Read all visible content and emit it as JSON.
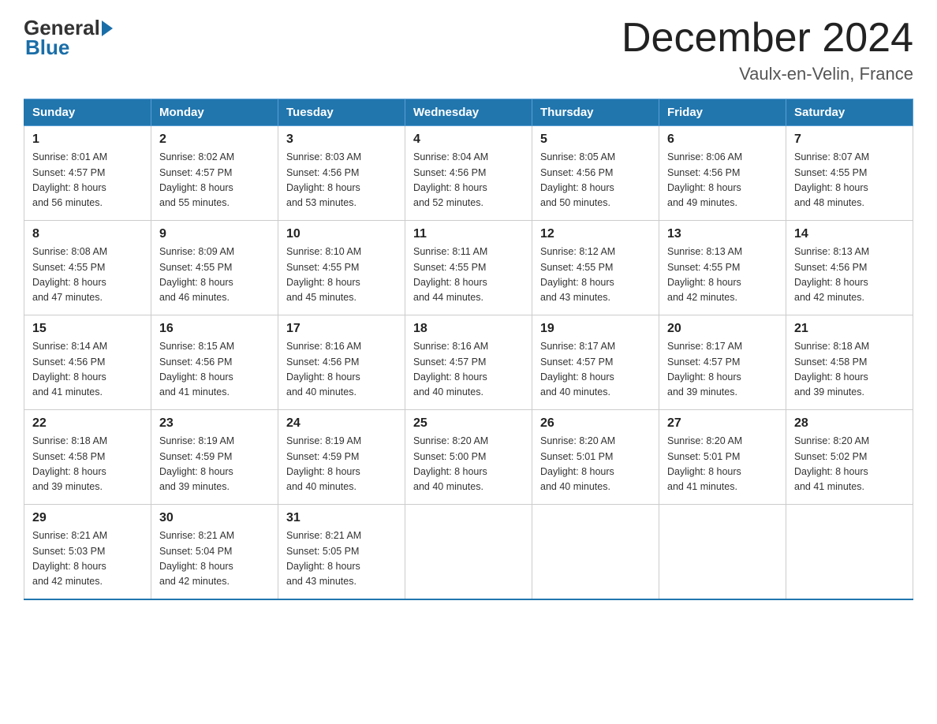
{
  "header": {
    "logo_general": "General",
    "logo_blue": "Blue",
    "month_title": "December 2024",
    "location": "Vaulx-en-Velin, France"
  },
  "weekdays": [
    "Sunday",
    "Monday",
    "Tuesday",
    "Wednesday",
    "Thursday",
    "Friday",
    "Saturday"
  ],
  "weeks": [
    [
      {
        "day": "1",
        "sunrise": "8:01 AM",
        "sunset": "4:57 PM",
        "daylight": "8 hours and 56 minutes."
      },
      {
        "day": "2",
        "sunrise": "8:02 AM",
        "sunset": "4:57 PM",
        "daylight": "8 hours and 55 minutes."
      },
      {
        "day": "3",
        "sunrise": "8:03 AM",
        "sunset": "4:56 PM",
        "daylight": "8 hours and 53 minutes."
      },
      {
        "day": "4",
        "sunrise": "8:04 AM",
        "sunset": "4:56 PM",
        "daylight": "8 hours and 52 minutes."
      },
      {
        "day": "5",
        "sunrise": "8:05 AM",
        "sunset": "4:56 PM",
        "daylight": "8 hours and 50 minutes."
      },
      {
        "day": "6",
        "sunrise": "8:06 AM",
        "sunset": "4:56 PM",
        "daylight": "8 hours and 49 minutes."
      },
      {
        "day": "7",
        "sunrise": "8:07 AM",
        "sunset": "4:55 PM",
        "daylight": "8 hours and 48 minutes."
      }
    ],
    [
      {
        "day": "8",
        "sunrise": "8:08 AM",
        "sunset": "4:55 PM",
        "daylight": "8 hours and 47 minutes."
      },
      {
        "day": "9",
        "sunrise": "8:09 AM",
        "sunset": "4:55 PM",
        "daylight": "8 hours and 46 minutes."
      },
      {
        "day": "10",
        "sunrise": "8:10 AM",
        "sunset": "4:55 PM",
        "daylight": "8 hours and 45 minutes."
      },
      {
        "day": "11",
        "sunrise": "8:11 AM",
        "sunset": "4:55 PM",
        "daylight": "8 hours and 44 minutes."
      },
      {
        "day": "12",
        "sunrise": "8:12 AM",
        "sunset": "4:55 PM",
        "daylight": "8 hours and 43 minutes."
      },
      {
        "day": "13",
        "sunrise": "8:13 AM",
        "sunset": "4:55 PM",
        "daylight": "8 hours and 42 minutes."
      },
      {
        "day": "14",
        "sunrise": "8:13 AM",
        "sunset": "4:56 PM",
        "daylight": "8 hours and 42 minutes."
      }
    ],
    [
      {
        "day": "15",
        "sunrise": "8:14 AM",
        "sunset": "4:56 PM",
        "daylight": "8 hours and 41 minutes."
      },
      {
        "day": "16",
        "sunrise": "8:15 AM",
        "sunset": "4:56 PM",
        "daylight": "8 hours and 41 minutes."
      },
      {
        "day": "17",
        "sunrise": "8:16 AM",
        "sunset": "4:56 PM",
        "daylight": "8 hours and 40 minutes."
      },
      {
        "day": "18",
        "sunrise": "8:16 AM",
        "sunset": "4:57 PM",
        "daylight": "8 hours and 40 minutes."
      },
      {
        "day": "19",
        "sunrise": "8:17 AM",
        "sunset": "4:57 PM",
        "daylight": "8 hours and 40 minutes."
      },
      {
        "day": "20",
        "sunrise": "8:17 AM",
        "sunset": "4:57 PM",
        "daylight": "8 hours and 39 minutes."
      },
      {
        "day": "21",
        "sunrise": "8:18 AM",
        "sunset": "4:58 PM",
        "daylight": "8 hours and 39 minutes."
      }
    ],
    [
      {
        "day": "22",
        "sunrise": "8:18 AM",
        "sunset": "4:58 PM",
        "daylight": "8 hours and 39 minutes."
      },
      {
        "day": "23",
        "sunrise": "8:19 AM",
        "sunset": "4:59 PM",
        "daylight": "8 hours and 39 minutes."
      },
      {
        "day": "24",
        "sunrise": "8:19 AM",
        "sunset": "4:59 PM",
        "daylight": "8 hours and 40 minutes."
      },
      {
        "day": "25",
        "sunrise": "8:20 AM",
        "sunset": "5:00 PM",
        "daylight": "8 hours and 40 minutes."
      },
      {
        "day": "26",
        "sunrise": "8:20 AM",
        "sunset": "5:01 PM",
        "daylight": "8 hours and 40 minutes."
      },
      {
        "day": "27",
        "sunrise": "8:20 AM",
        "sunset": "5:01 PM",
        "daylight": "8 hours and 41 minutes."
      },
      {
        "day": "28",
        "sunrise": "8:20 AM",
        "sunset": "5:02 PM",
        "daylight": "8 hours and 41 minutes."
      }
    ],
    [
      {
        "day": "29",
        "sunrise": "8:21 AM",
        "sunset": "5:03 PM",
        "daylight": "8 hours and 42 minutes."
      },
      {
        "day": "30",
        "sunrise": "8:21 AM",
        "sunset": "5:04 PM",
        "daylight": "8 hours and 42 minutes."
      },
      {
        "day": "31",
        "sunrise": "8:21 AM",
        "sunset": "5:05 PM",
        "daylight": "8 hours and 43 minutes."
      },
      null,
      null,
      null,
      null
    ]
  ],
  "labels": {
    "sunrise": "Sunrise:",
    "sunset": "Sunset:",
    "daylight": "Daylight:"
  }
}
